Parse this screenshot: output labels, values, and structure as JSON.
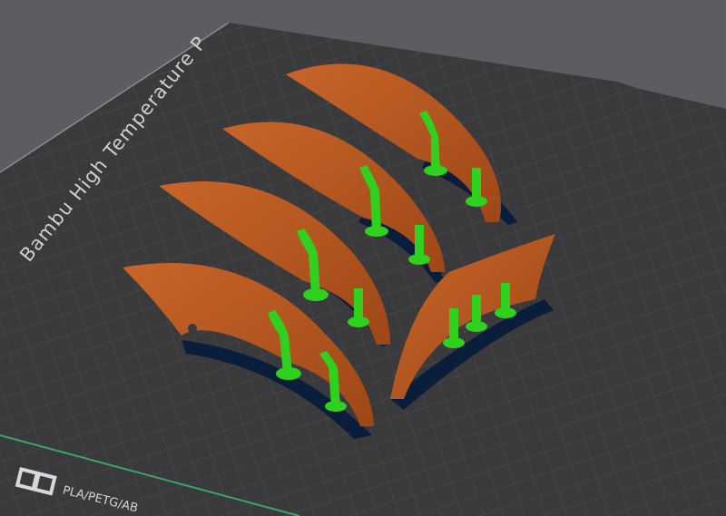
{
  "app": {
    "view": "3D slicer preview - build plate"
  },
  "plate": {
    "label": "Bambu High Temperature P",
    "bottom_label": "PLA/PETG/AB",
    "logo_icon": "bambu-logo-icon",
    "colors": {
      "background": "#5c5d60",
      "plate": "#3a3a3c",
      "grid": "#4e4e52",
      "edge_highlight": "#3fa46a"
    }
  },
  "objects": {
    "part_color": "#b5561e",
    "support_color": "#2fd01e",
    "shadow_color": "#0a1e3c",
    "part_count": 5
  }
}
